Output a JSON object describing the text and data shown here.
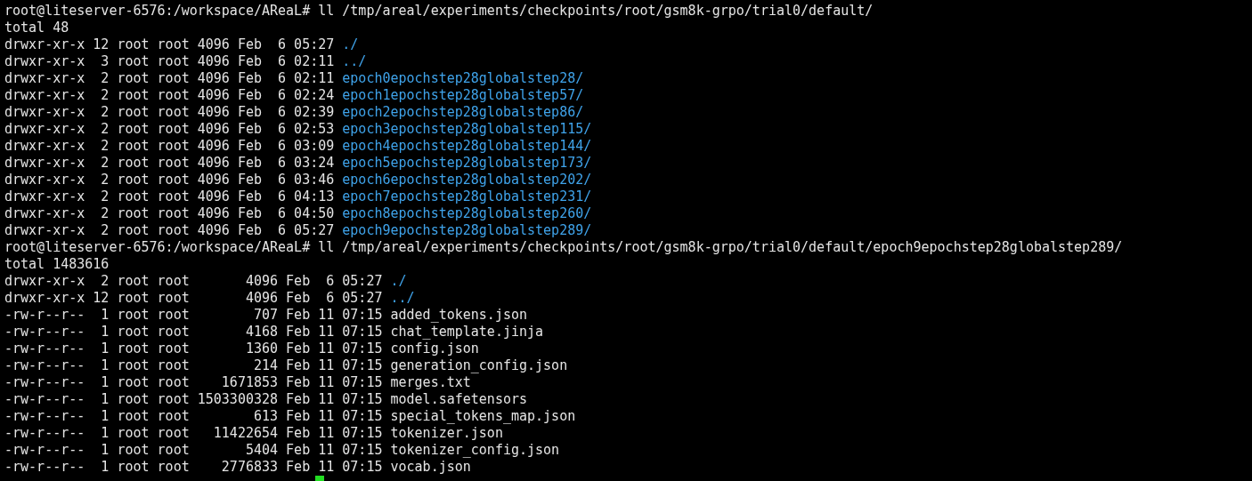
{
  "sessions": [
    {
      "command": "root@liteserver-6576:/workspace/AReaL# ll /tmp/areal/experiments/checkpoints/root/gsm8k-grpo/trial0/default/",
      "total": "total 48",
      "entries": [
        {
          "details": "drwxr-xr-x 12 root root 4096 Feb  6 05:27",
          "name": "./",
          "kind": "dir"
        },
        {
          "details": "drwxr-xr-x  3 root root 4096 Feb  6 02:11",
          "name": "../",
          "kind": "dir"
        },
        {
          "details": "drwxr-xr-x  2 root root 4096 Feb  6 02:11",
          "name": "epoch0epochstep28globalstep28/",
          "kind": "dir"
        },
        {
          "details": "drwxr-xr-x  2 root root 4096 Feb  6 02:24",
          "name": "epoch1epochstep28globalstep57/",
          "kind": "dir"
        },
        {
          "details": "drwxr-xr-x  2 root root 4096 Feb  6 02:39",
          "name": "epoch2epochstep28globalstep86/",
          "kind": "dir"
        },
        {
          "details": "drwxr-xr-x  2 root root 4096 Feb  6 02:53",
          "name": "epoch3epochstep28globalstep115/",
          "kind": "dir"
        },
        {
          "details": "drwxr-xr-x  2 root root 4096 Feb  6 03:09",
          "name": "epoch4epochstep28globalstep144/",
          "kind": "dir"
        },
        {
          "details": "drwxr-xr-x  2 root root 4096 Feb  6 03:24",
          "name": "epoch5epochstep28globalstep173/",
          "kind": "dir"
        },
        {
          "details": "drwxr-xr-x  2 root root 4096 Feb  6 03:46",
          "name": "epoch6epochstep28globalstep202/",
          "kind": "dir"
        },
        {
          "details": "drwxr-xr-x  2 root root 4096 Feb  6 04:13",
          "name": "epoch7epochstep28globalstep231/",
          "kind": "dir"
        },
        {
          "details": "drwxr-xr-x  2 root root 4096 Feb  6 04:50",
          "name": "epoch8epochstep28globalstep260/",
          "kind": "dir"
        },
        {
          "details": "drwxr-xr-x  2 root root 4096 Feb  6 05:27",
          "name": "epoch9epochstep28globalstep289/",
          "kind": "dir"
        }
      ]
    },
    {
      "command": "root@liteserver-6576:/workspace/AReaL# ll /tmp/areal/experiments/checkpoints/root/gsm8k-grpo/trial0/default/epoch9epochstep28globalstep289/",
      "total": "total 1483616",
      "entries": [
        {
          "details": "drwxr-xr-x  2 root root       4096 Feb  6 05:27",
          "name": "./",
          "kind": "dir"
        },
        {
          "details": "drwxr-xr-x 12 root root       4096 Feb  6 05:27",
          "name": "../",
          "kind": "dir"
        },
        {
          "details": "-rw-r--r--  1 root root        707 Feb 11 07:15",
          "name": "added_tokens.json",
          "kind": "file"
        },
        {
          "details": "-rw-r--r--  1 root root       4168 Feb 11 07:15",
          "name": "chat_template.jinja",
          "kind": "file"
        },
        {
          "details": "-rw-r--r--  1 root root       1360 Feb 11 07:15",
          "name": "config.json",
          "kind": "file"
        },
        {
          "details": "-rw-r--r--  1 root root        214 Feb 11 07:15",
          "name": "generation_config.json",
          "kind": "file"
        },
        {
          "details": "-rw-r--r--  1 root root    1671853 Feb 11 07:15",
          "name": "merges.txt",
          "kind": "file"
        },
        {
          "details": "-rw-r--r--  1 root root 1503300328 Feb 11 07:15",
          "name": "model.safetensors",
          "kind": "file"
        },
        {
          "details": "-rw-r--r--  1 root root        613 Feb 11 07:15",
          "name": "special_tokens_map.json",
          "kind": "file"
        },
        {
          "details": "-rw-r--r--  1 root root   11422654 Feb 11 07:15",
          "name": "tokenizer.json",
          "kind": "file"
        },
        {
          "details": "-rw-r--r--  1 root root       5404 Feb 11 07:15",
          "name": "tokenizer_config.json",
          "kind": "file"
        },
        {
          "details": "-rw-r--r--  1 root root    2776833 Feb 11 07:15",
          "name": "vocab.json",
          "kind": "file"
        }
      ]
    }
  ]
}
